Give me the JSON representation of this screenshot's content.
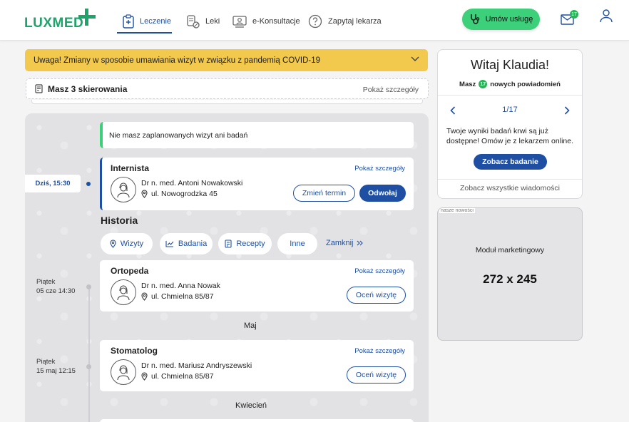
{
  "brand": {
    "name": "LUXMED",
    "green": "#1ea36b",
    "blue": "#1e4fa3",
    "cta_green": "#3dd07a",
    "alert_yellow": "#f2c94c"
  },
  "nav": {
    "items": [
      {
        "label": "Leczenie",
        "icon": "clipboard-medical-icon",
        "active": true
      },
      {
        "label": "Leki",
        "icon": "pills-icon",
        "active": false
      },
      {
        "label": "e-Konsultacje",
        "icon": "video-consult-icon",
        "active": false
      },
      {
        "label": "Zapytaj lekarza",
        "icon": "question-icon",
        "active": false
      }
    ],
    "book_button": "Umów usługę",
    "mail_count": "17"
  },
  "alert": {
    "text": "Uwaga! Zmiany w sposobie umawiania wizyt w związku z pandemią COVID-19"
  },
  "referrals": {
    "title": "Masz 3 skierowania",
    "link": "Pokaż szczegóły"
  },
  "timeline": {
    "no_visits": "Nie masz zaplanowanych wizyt ani badań",
    "today_label": "Dziś, 15:30",
    "upcoming": {
      "title": "Internista",
      "link": "Pokaż szczegóły",
      "doctor": "Dr n. med. Antoni Nowakowski",
      "address": "ul. Nowogrodzka 45",
      "change_button": "Zmień termin",
      "cancel_button": "Odwołaj"
    },
    "history_title": "Historia",
    "filters": [
      "Wizyty",
      "Badania",
      "Recepty",
      "Inne"
    ],
    "collapse_label": "Zamknij",
    "past": [
      {
        "day": "Piątek",
        "date": "05 cze 14:30",
        "title": "Ortopeda",
        "link": "Pokaż szczegóły",
        "doctor": "Dr n. med. Anna Nowak",
        "address": "ul. Chmielna 85/87",
        "rate_button": "Oceń wizytę"
      },
      {
        "day": "Piątek",
        "date": "15 maj 12:15",
        "title": "Stomatolog",
        "link": "Pokaż szczegóły",
        "doctor": "Dr n. med. Mariusz Andryszewski",
        "address": "ul. Chmielna 85/87",
        "rate_button": "Oceń wizytę"
      }
    ],
    "months": [
      "Maj",
      "Kwiecień"
    ]
  },
  "welcome": {
    "greeting": "Witaj Klaudia!",
    "notif_prefix": "Masz",
    "notif_count": "17",
    "notif_suffix": "nowych powiadomień",
    "pager": "1/17",
    "message": "Twoje wyniki badań krwi są już dostępne! Omów je z lekarzem online.",
    "button": "Zobacz badanie",
    "all_link": "Zobacz wszystkie wiadomości"
  },
  "marketing": {
    "tag": "nasze nowości",
    "label": "Moduł marketingowy",
    "size": "272 x 245"
  }
}
